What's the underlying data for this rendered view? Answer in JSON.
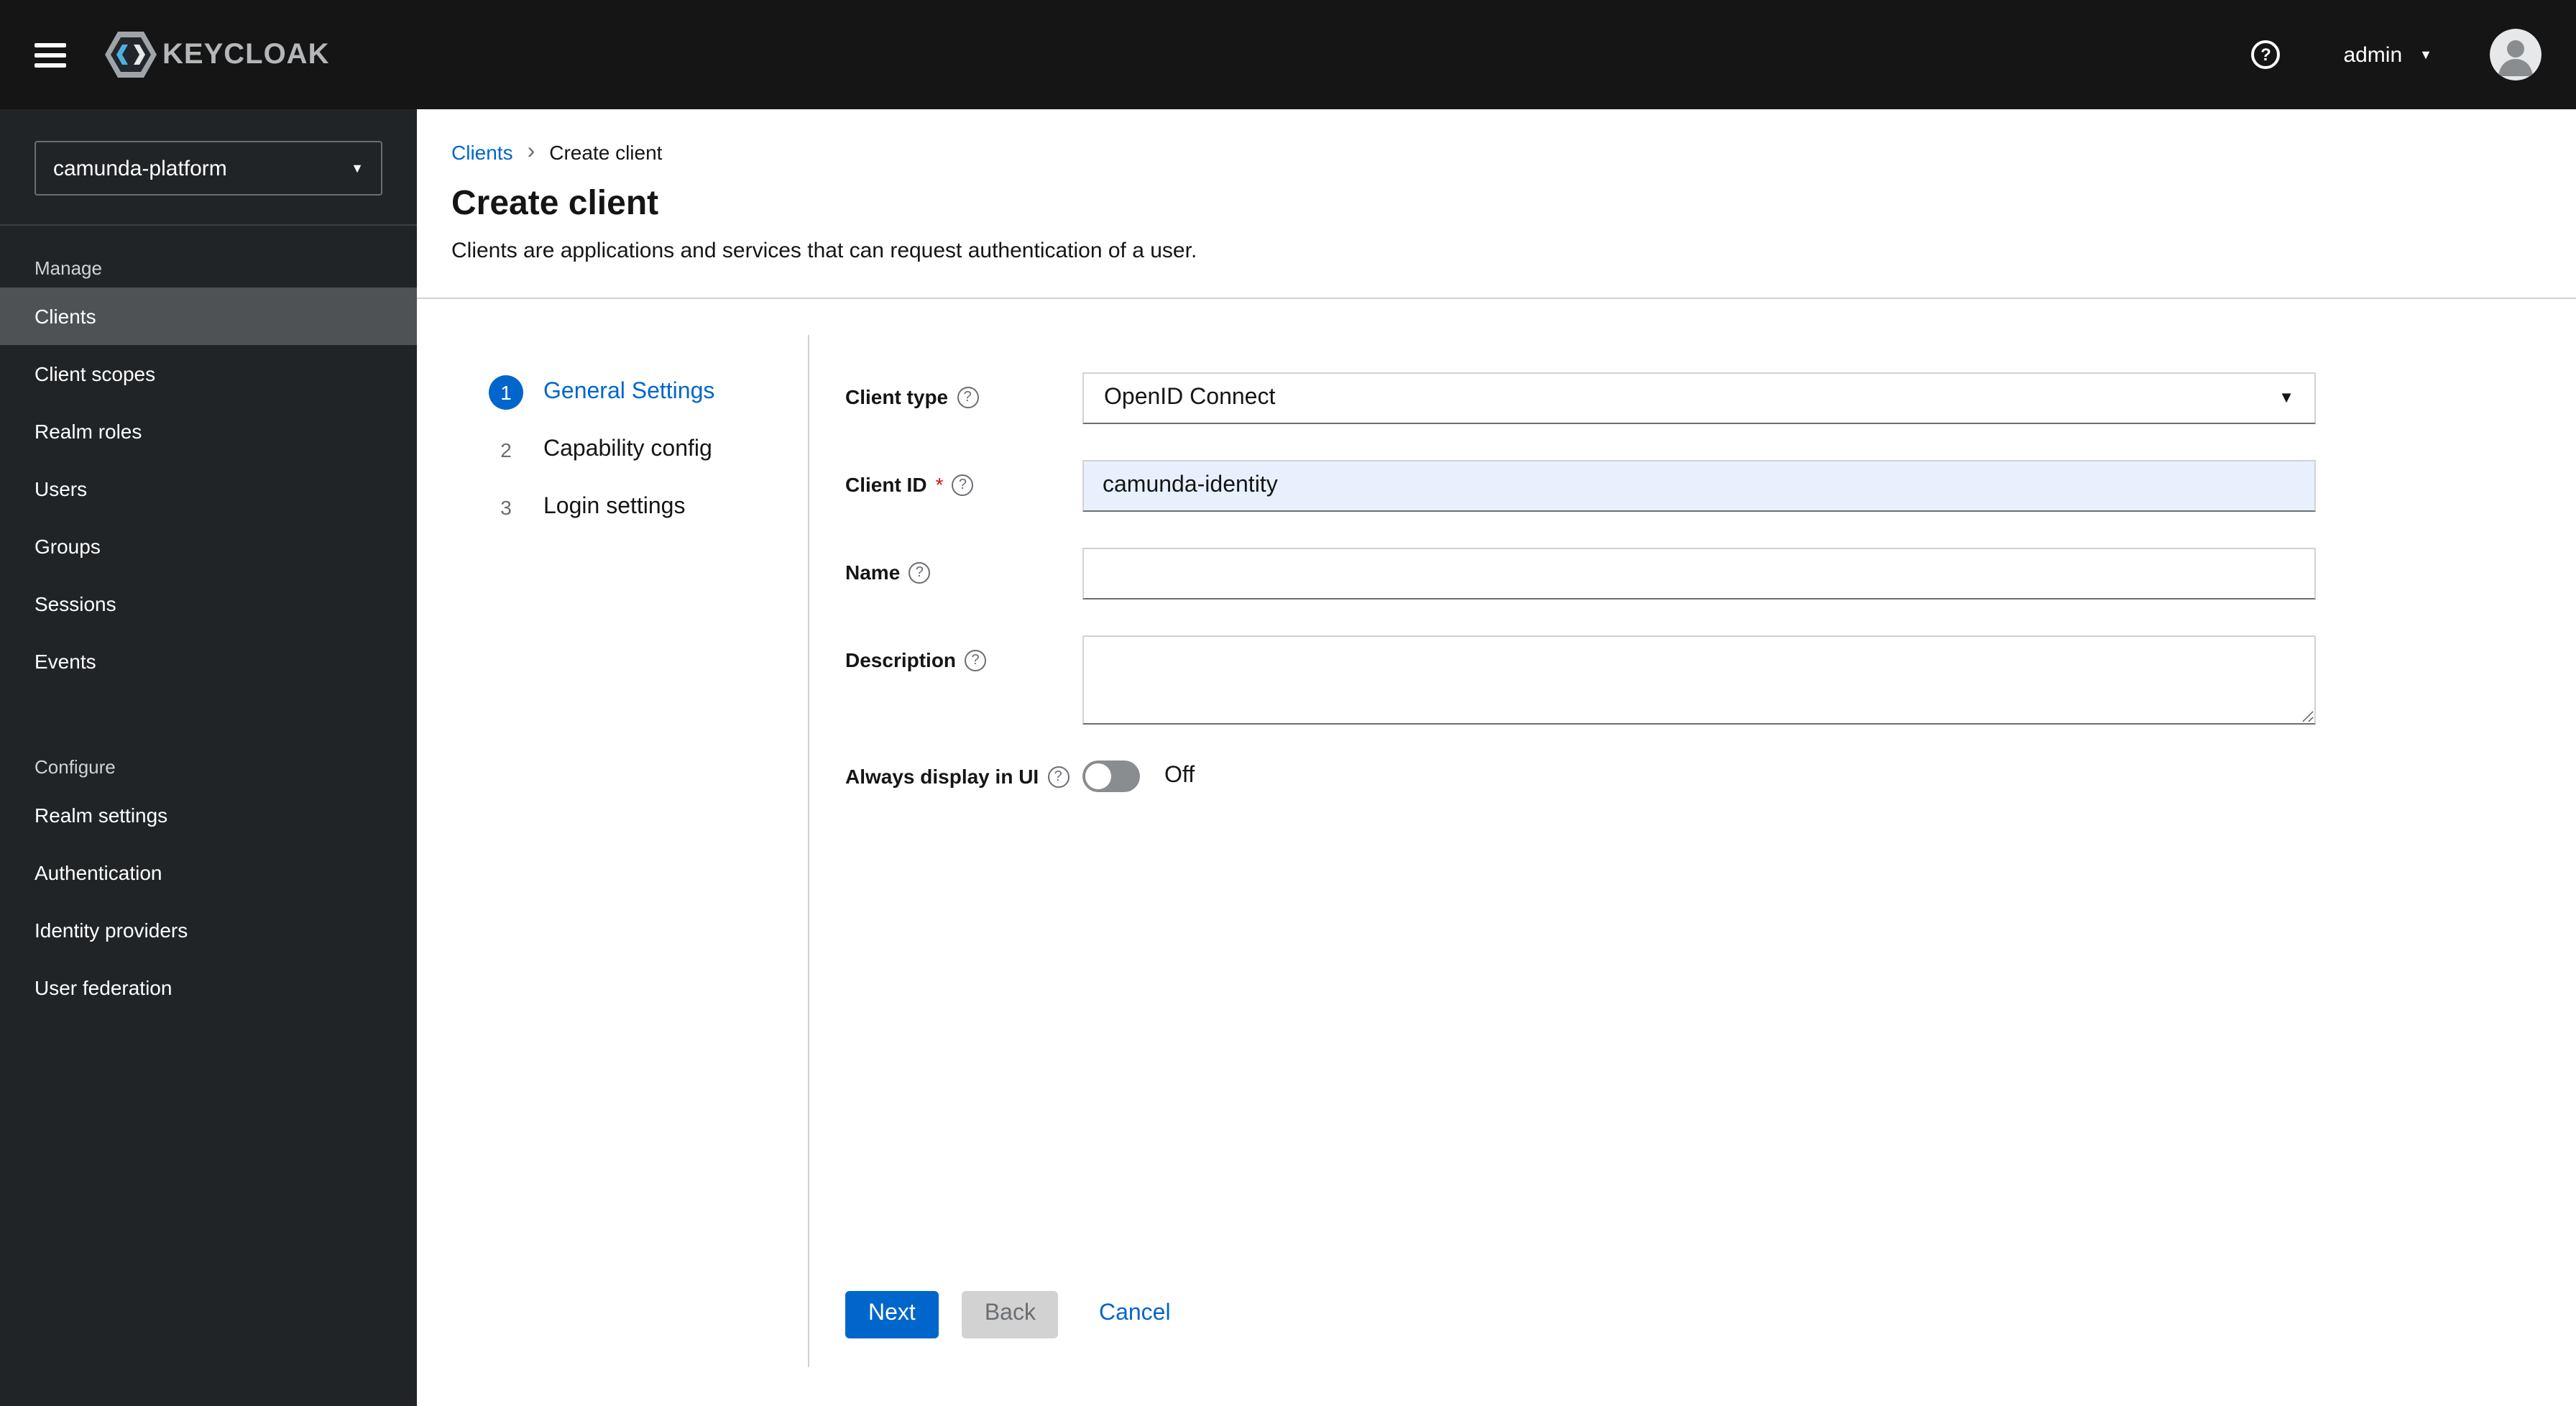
{
  "header": {
    "brand": "KEYCLOAK",
    "user_menu": {
      "label": "admin"
    }
  },
  "icons": {
    "help": "?",
    "caret_down": "▼",
    "breadcrumb_sep": "›"
  },
  "sidebar": {
    "realm_selector": {
      "value": "camunda-platform"
    },
    "sections": [
      {
        "label": "Manage",
        "items": [
          {
            "label": "Clients",
            "active": true
          },
          {
            "label": "Client scopes"
          },
          {
            "label": "Realm roles"
          },
          {
            "label": "Users"
          },
          {
            "label": "Groups"
          },
          {
            "label": "Sessions"
          },
          {
            "label": "Events"
          }
        ]
      },
      {
        "label": "Configure",
        "items": [
          {
            "label": "Realm settings"
          },
          {
            "label": "Authentication"
          },
          {
            "label": "Identity providers"
          },
          {
            "label": "User federation"
          }
        ]
      }
    ]
  },
  "breadcrumb": {
    "items": [
      {
        "label": "Clients"
      },
      {
        "label": "Create client"
      }
    ]
  },
  "page": {
    "title": "Create client",
    "subtitle": "Clients are applications and services that can request authentication of a user."
  },
  "wizard": {
    "steps": [
      {
        "number": "1",
        "label": "General Settings",
        "active": true
      },
      {
        "number": "2",
        "label": "Capability config",
        "active": false
      },
      {
        "number": "3",
        "label": "Login settings",
        "active": false
      }
    ]
  },
  "form": {
    "client_type": {
      "label": "Client type",
      "value": "OpenID Connect"
    },
    "client_id": {
      "label": "Client ID",
      "required_marker": "*",
      "value": "camunda-identity"
    },
    "name": {
      "label": "Name",
      "value": ""
    },
    "description": {
      "label": "Description",
      "value": ""
    },
    "always_display_in_ui": {
      "label": "Always display in UI",
      "state": "Off"
    }
  },
  "actions": {
    "next": "Next",
    "back": "Back",
    "cancel": "Cancel"
  },
  "colors": {
    "primary": "#0066cc",
    "masthead_bg": "#151515",
    "sidebar_bg": "#212427",
    "sidebar_active_bg": "#4f5255",
    "client_id_field_bg": "#e8f0fe",
    "required_red": "#c9190b"
  }
}
